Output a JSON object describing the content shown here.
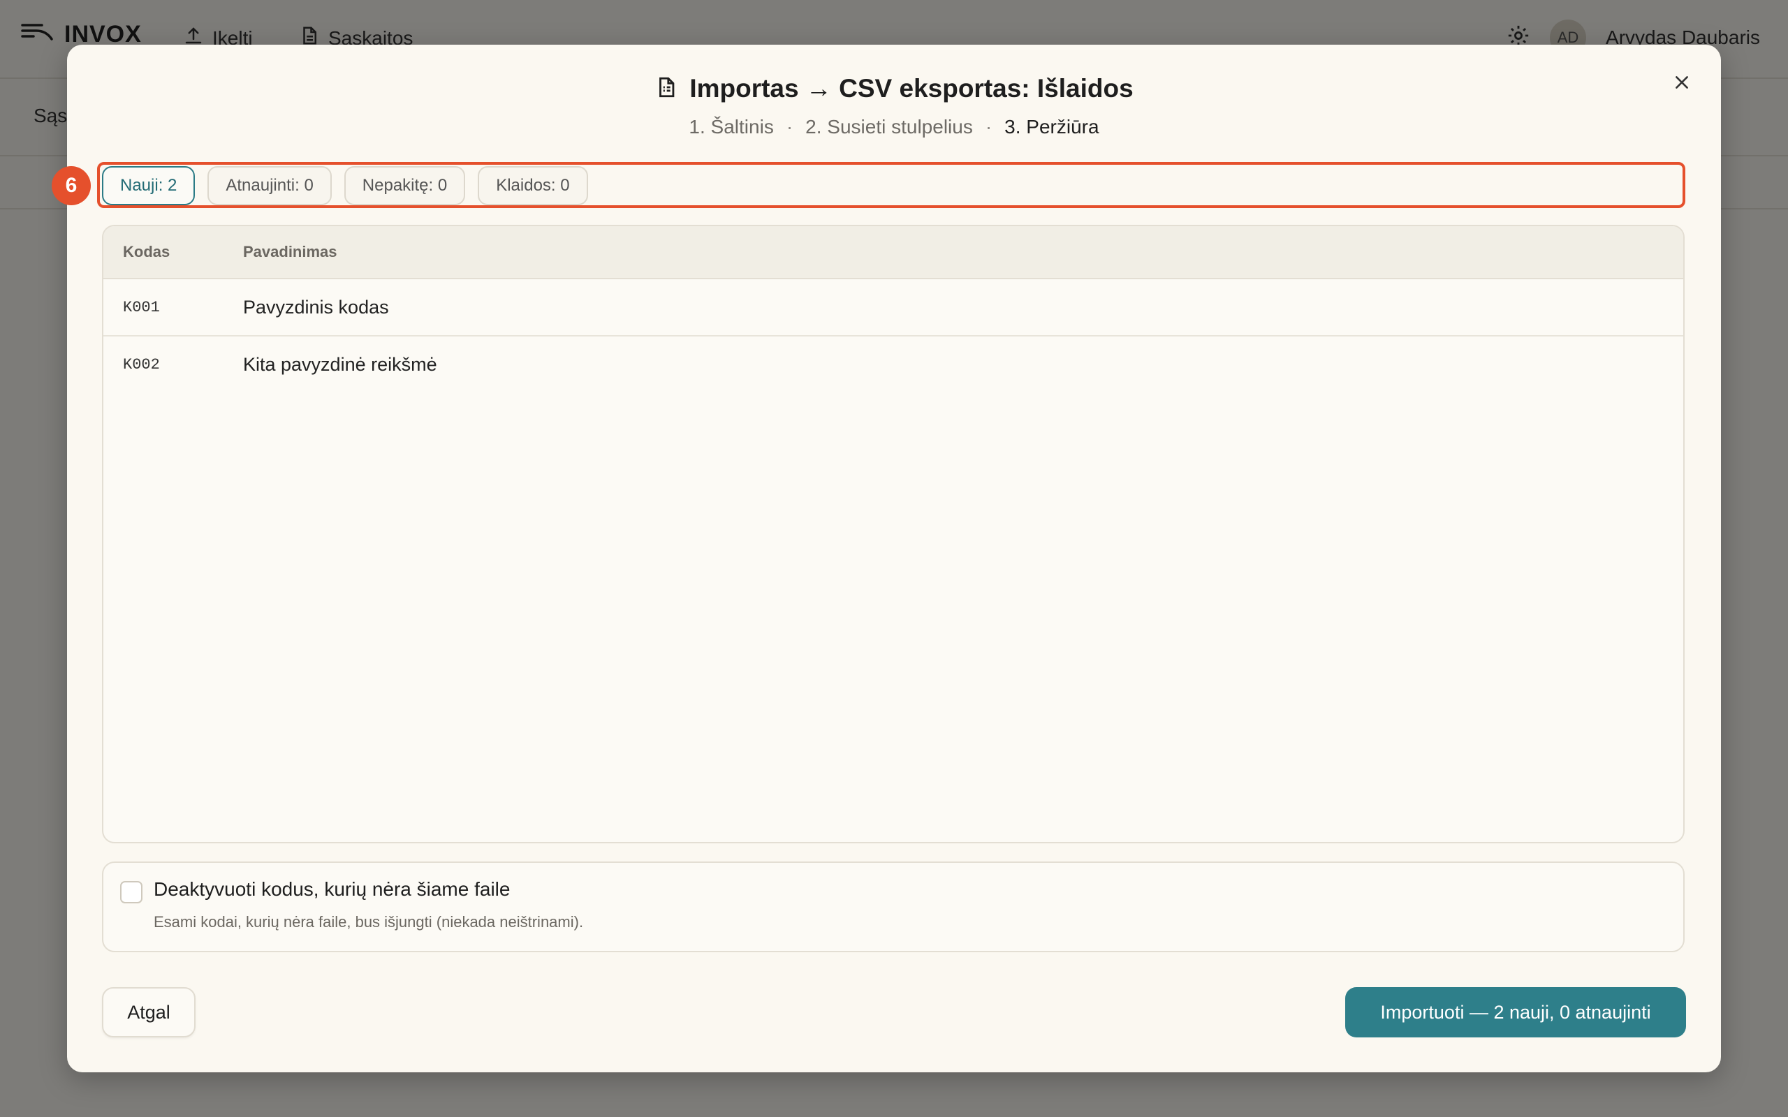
{
  "app": {
    "logo_text": "INVOX",
    "nav": [
      {
        "label": "Įkelti",
        "icon": "upload-icon"
      },
      {
        "label": "Sąskaitos",
        "icon": "document-icon"
      }
    ],
    "user": {
      "initials": "AD",
      "name": "Arvydas Daubaris"
    },
    "subbar_text": "Sąs"
  },
  "modal": {
    "title": "Importas → CSV eksportas: Išlaidos",
    "steps": [
      "1. Šaltinis",
      "2. Susieti stulpelius",
      "3. Peržiūra"
    ],
    "step_separator": "·",
    "active_step": 2,
    "annotation_badge": "6",
    "chips": [
      {
        "label": "Nauji: 2",
        "active": true
      },
      {
        "label": "Atnaujinti: 0",
        "active": false
      },
      {
        "label": "Nepakitę: 0",
        "active": false
      },
      {
        "label": "Klaidos: 0",
        "active": false
      }
    ],
    "table": {
      "headers": [
        "Kodas",
        "Pavadinimas"
      ],
      "rows": [
        {
          "code": "K001",
          "name": "Pavyzdinis kodas"
        },
        {
          "code": "K002",
          "name": "Kita pavyzdinė reikšmė"
        }
      ]
    },
    "deactivate": {
      "checked": false,
      "title": "Deaktyvuoti kodus, kurių nėra šiame faile",
      "description": "Esami kodai, kurių nėra faile, bus išjungti (niekada neištrinami)."
    },
    "back_label": "Atgal",
    "import_label": "Importuoti — 2 nauji, 0 atnaujinti"
  },
  "colors": {
    "accent": "#2e7f8a",
    "highlight": "#e5502c",
    "modal_bg": "#fbf8f1"
  }
}
